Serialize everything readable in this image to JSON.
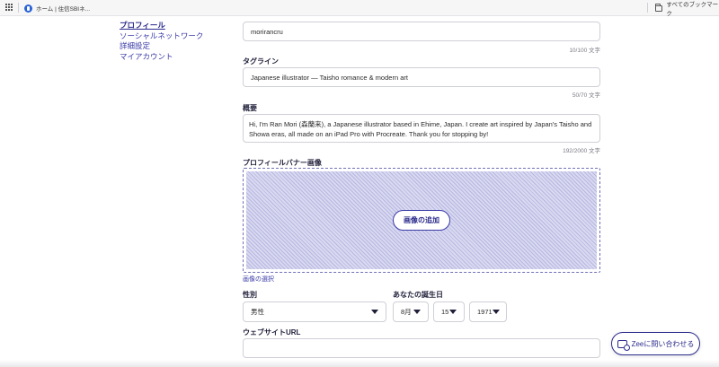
{
  "bookmarks_bar": {
    "bookmark_1": "ホーム | 住信SBIネ...",
    "all_bookmarks": "すべてのブックマーク"
  },
  "left_nav": {
    "items": [
      {
        "label": "プロフィール",
        "active": true
      },
      {
        "label": "ソーシャルネットワーク",
        "active": false
      },
      {
        "label": "詳細設定",
        "active": false
      },
      {
        "label": "マイアカウント",
        "active": false
      }
    ]
  },
  "form": {
    "username": {
      "value": "morirancru",
      "counter": "10/100 文字"
    },
    "tagline": {
      "label": "タグライン",
      "value": "Japanese illustrator — Taisho romance & modern art",
      "counter": "50/70 文字"
    },
    "summary": {
      "label": "概要",
      "value": "Hi, I'm Ran Mori (森蘭来), a Japanese illustrator based in Ehime, Japan. I create art inspired by Japan's Taisho and Showa eras, all made on an iPad Pro with Procreate. Thank you for stopping by!",
      "counter": "192/2000 文字"
    },
    "banner": {
      "label": "プロフィールバナー画像",
      "add_button": "画像の追加",
      "choose_link": "画像の選択"
    },
    "gender": {
      "label": "性別",
      "value": "男性"
    },
    "birthday": {
      "label": "あなたの誕生日",
      "month": "8月",
      "day": "15",
      "year": "1971"
    },
    "website": {
      "label": "ウェブサイトURL",
      "value": ""
    }
  },
  "contact_widget": {
    "label": "Zeeに問い合わせる"
  },
  "colors": {
    "accent": "#2b2b8c",
    "link": "#3a3aa8",
    "banner_fill": "#d9d9f0"
  }
}
